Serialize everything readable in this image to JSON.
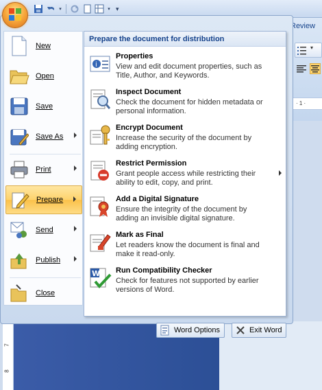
{
  "ribbon": {
    "tab_review": "Review",
    "ruler_text": "· 1 ·"
  },
  "ruler_left_numbers": [
    "7",
    "8"
  ],
  "menu": {
    "left_items": [
      {
        "label": "New",
        "icon": "new-document-icon",
        "has_arrow": false
      },
      {
        "label": "Open",
        "icon": "open-folder-icon",
        "has_arrow": false
      },
      {
        "label": "Save",
        "icon": "save-disk-icon",
        "has_arrow": false
      },
      {
        "label": "Save As",
        "icon": "save-as-icon",
        "has_arrow": true
      },
      {
        "label": "Print",
        "icon": "printer-icon",
        "has_arrow": true
      },
      {
        "label": "Prepare",
        "icon": "prepare-pen-icon",
        "has_arrow": true,
        "selected": true
      },
      {
        "label": "Send",
        "icon": "send-icon",
        "has_arrow": true
      },
      {
        "label": "Publish",
        "icon": "publish-icon",
        "has_arrow": true
      },
      {
        "label": "Close",
        "icon": "close-folder-icon",
        "has_arrow": false
      }
    ],
    "right_header": "Prepare the document for distribution",
    "right_items": [
      {
        "title": "Properties",
        "desc": "View and edit document properties, such as Title, Author, and Keywords.",
        "icon": "properties-icon"
      },
      {
        "title": "Inspect Document",
        "desc": "Check the document for hidden metadata or personal information.",
        "icon": "inspect-document-icon"
      },
      {
        "title": "Encrypt Document",
        "desc": "Increase the security of the document by adding encryption.",
        "icon": "encrypt-key-icon"
      },
      {
        "title": "Restrict Permission",
        "desc": "Grant people access while restricting their ability to edit, copy, and print.",
        "icon": "restrict-permission-icon",
        "has_submenu": true
      },
      {
        "title": "Add a Digital Signature",
        "desc": "Ensure the integrity of the document by adding an invisible digital signature.",
        "icon": "digital-signature-icon"
      },
      {
        "title": "Mark as Final",
        "desc": "Let readers know the document is final and make it read-only.",
        "icon": "mark-final-icon"
      },
      {
        "title": "Run Compatibility Checker",
        "desc": "Check for features not supported by earlier versions of Word.",
        "icon": "compatibility-checker-icon"
      }
    ],
    "footer": {
      "word_options": "Word Options",
      "exit_word": "Exit Word"
    }
  },
  "colors": {
    "accent": "#15428b",
    "selected_bg": "#fdd36c",
    "doc_blue": "#2c4f96"
  }
}
